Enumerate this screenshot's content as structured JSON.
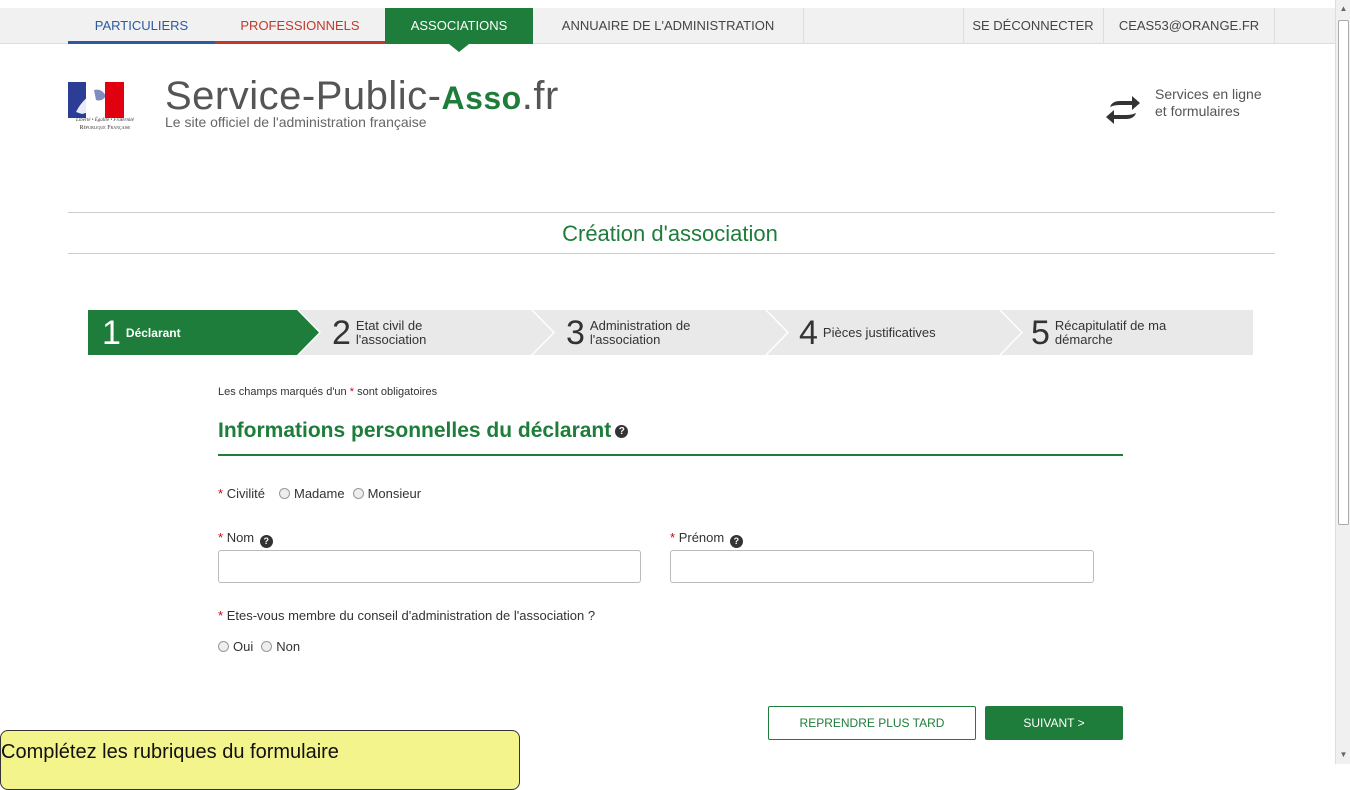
{
  "nav": {
    "particuliers": "PARTICULIERS",
    "professionnels": "PROFESSIONNELS",
    "associations": "ASSOCIATIONS",
    "annuaire": "ANNUAIRE DE L'ADMINISTRATION",
    "deconnecter": "SE DÉCONNECTER",
    "email": "CEAS53@ORANGE.FR"
  },
  "logo": {
    "motto": "Liberté • Égalité • Fraternité",
    "republic": "République Française"
  },
  "site": {
    "title_main": "Service-Public-",
    "title_asso": "Asso",
    "title_tld": ".fr",
    "subtitle": "Le site officiel de l'administration française"
  },
  "services": {
    "line1": "Services en ligne",
    "line2": "et formulaires"
  },
  "page": {
    "title": "Création d'association"
  },
  "steps": [
    {
      "num": "1",
      "line1": "Déclarant",
      "line2": ""
    },
    {
      "num": "2",
      "line1": "Etat civil de",
      "line2": "l'association"
    },
    {
      "num": "3",
      "line1": "Administration de",
      "line2": "l'association"
    },
    {
      "num": "4",
      "line1": "Pièces justificatives",
      "line2": ""
    },
    {
      "num": "5",
      "line1": "Récapitulatif de ma",
      "line2": "démarche"
    }
  ],
  "form": {
    "mandatory_pre": "Les champs marqués d'un ",
    "mandatory_star": "*",
    "mandatory_post": " sont obligatoires",
    "section_title": "Informations personnelles du déclarant",
    "civilite_label": "Civilité",
    "civilite_opt1": "Madame",
    "civilite_opt2": "Monsieur",
    "nom_label": "Nom",
    "prenom_label": "Prénom",
    "nom_value": "",
    "prenom_value": "",
    "membre_label": "Etes-vous membre du conseil d'administration de l'association ?",
    "membre_opt1": "Oui",
    "membre_opt2": "Non"
  },
  "buttons": {
    "later": "REPRENDRE PLUS TARD",
    "next": "SUIVANT"
  },
  "tooltip": {
    "text": "Complétez les rubriques du formulaire"
  },
  "colors": {
    "brand_green": "#1e7d3a",
    "particuliers_blue": "#2c5aa0",
    "pro_red": "#c0392b"
  }
}
